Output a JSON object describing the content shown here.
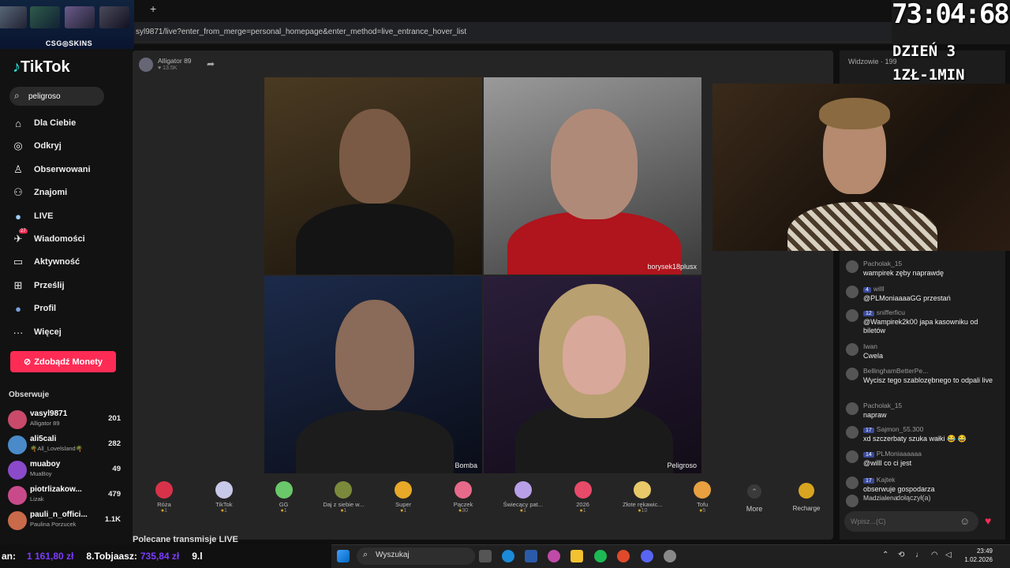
{
  "browser": {
    "url": "syl9871/live?enter_from_merge=personal_homepage&enter_method=live_entrance_hover_list",
    "new_tab": "+"
  },
  "banner": {
    "label": "CSG◎SKINS"
  },
  "sidebar": {
    "logo": "TikTok",
    "search_value": "peligroso",
    "nav": [
      {
        "label": "Dla Ciebie",
        "icon": "home-icon",
        "glyph": "⌂"
      },
      {
        "label": "Odkryj",
        "icon": "compass-icon",
        "glyph": "◎"
      },
      {
        "label": "Obserwowani",
        "icon": "person-plus-icon",
        "glyph": "♙"
      },
      {
        "label": "Znajomi",
        "icon": "friends-icon",
        "glyph": "⚇"
      },
      {
        "label": "LIVE",
        "icon": "live-icon",
        "glyph": "●"
      },
      {
        "label": "Wiadomości",
        "icon": "message-icon",
        "glyph": "✈"
      },
      {
        "label": "Aktywność",
        "icon": "activity-icon",
        "glyph": "▭"
      },
      {
        "label": "Prześlij",
        "icon": "upload-icon",
        "glyph": "⊞"
      },
      {
        "label": "Profil",
        "icon": "profile-icon",
        "glyph": "●"
      },
      {
        "label": "Więcej",
        "icon": "more-icon",
        "glyph": "···"
      }
    ],
    "messages_badge": "27",
    "coins_button": "Zdobądź Monety",
    "following_title": "Obserwuje",
    "following": [
      {
        "name": "vasyl9871",
        "sub": "Alligator 89",
        "count": "201"
      },
      {
        "name": "ali5cali",
        "sub": "🌴All_Lovelsland🌴",
        "count": "282"
      },
      {
        "name": "muaboy",
        "sub": "MuaBoy",
        "count": "49"
      },
      {
        "name": "piotrlizakow...",
        "sub": "Lizak",
        "count": "479"
      },
      {
        "name": "pauli_n_offici...",
        "sub": "Paulina Porzucek",
        "count": "1.1K"
      }
    ]
  },
  "live": {
    "host_name": "Alligator 89",
    "host_likes": "♥ 13.5K",
    "tiles": [
      {
        "label": ""
      },
      {
        "label": "borysek18plusx"
      },
      {
        "label": "Bomba"
      },
      {
        "label": "Peligroso"
      }
    ],
    "gifts": [
      {
        "name": "Róża",
        "price": "1"
      },
      {
        "name": "TikTok",
        "price": "1"
      },
      {
        "name": "GG",
        "price": "1"
      },
      {
        "name": "Daj z siebie w...",
        "price": "1"
      },
      {
        "name": "Super",
        "price": "1"
      },
      {
        "name": "Pączek",
        "price": "30"
      },
      {
        "name": "Świecący pat...",
        "price": "1"
      },
      {
        "name": "2026",
        "price": "1"
      },
      {
        "name": "Złote rękawic...",
        "price": "10"
      },
      {
        "name": "Tofu",
        "price": "5"
      }
    ],
    "more_label": "More",
    "recharge_label": "Recharge",
    "recommended_title": "Polecane transmisje LIVE"
  },
  "chat": {
    "viewers_label": "Widzowie · 199",
    "messages": [
      {
        "user": "Pacholak_15",
        "badge": "",
        "text": "wampirek zęby naprawdę"
      },
      {
        "user": "willl",
        "badge": "4",
        "text": "@PLMoniaaaaGG przestań"
      },
      {
        "user": "snifferficu",
        "badge": "12",
        "text": "@Wampirek2k00 japa kasowniku od biletów"
      },
      {
        "user": "Iwan",
        "badge": "",
        "text": "Cwela"
      },
      {
        "user": "BellinghamBetterPe...",
        "badge": "",
        "text": "Wycisz tego szablozębnego to odpali live"
      },
      {
        "user": "Pacholak_15",
        "badge": "",
        "text": "napraw"
      },
      {
        "user": "Sajmon_55.300",
        "badge": "17",
        "text": "xd szczerbaty szuka wałki 😂 😂"
      },
      {
        "user": "PLMoniaaaaaa",
        "badge": "14",
        "text": "@willl co ci jest"
      },
      {
        "user": "Kajtek",
        "badge": "17",
        "text": "obserwuje gospodarza"
      },
      {
        "user": "Madzialena",
        "badge": "",
        "text": "dołączył(a)"
      }
    ],
    "input_placeholder": "Wpisz...(C)"
  },
  "overlay": {
    "timer": "73:04:68",
    "day": "DZIEŃ 3",
    "rate": "1ZŁ-1MIN"
  },
  "ticker": {
    "prefix": "an:",
    "amount1": "1 161,80 zł",
    "entry": "8.Tobjaasz:",
    "amount2": "735,84 zł",
    "next": "9.l"
  },
  "taskbar": {
    "search_label": "Wyszukaj",
    "time": "23:49",
    "date": "1.02.2026"
  },
  "colors": {
    "accent": "#fe2c55",
    "donation": "#7c3cff"
  }
}
